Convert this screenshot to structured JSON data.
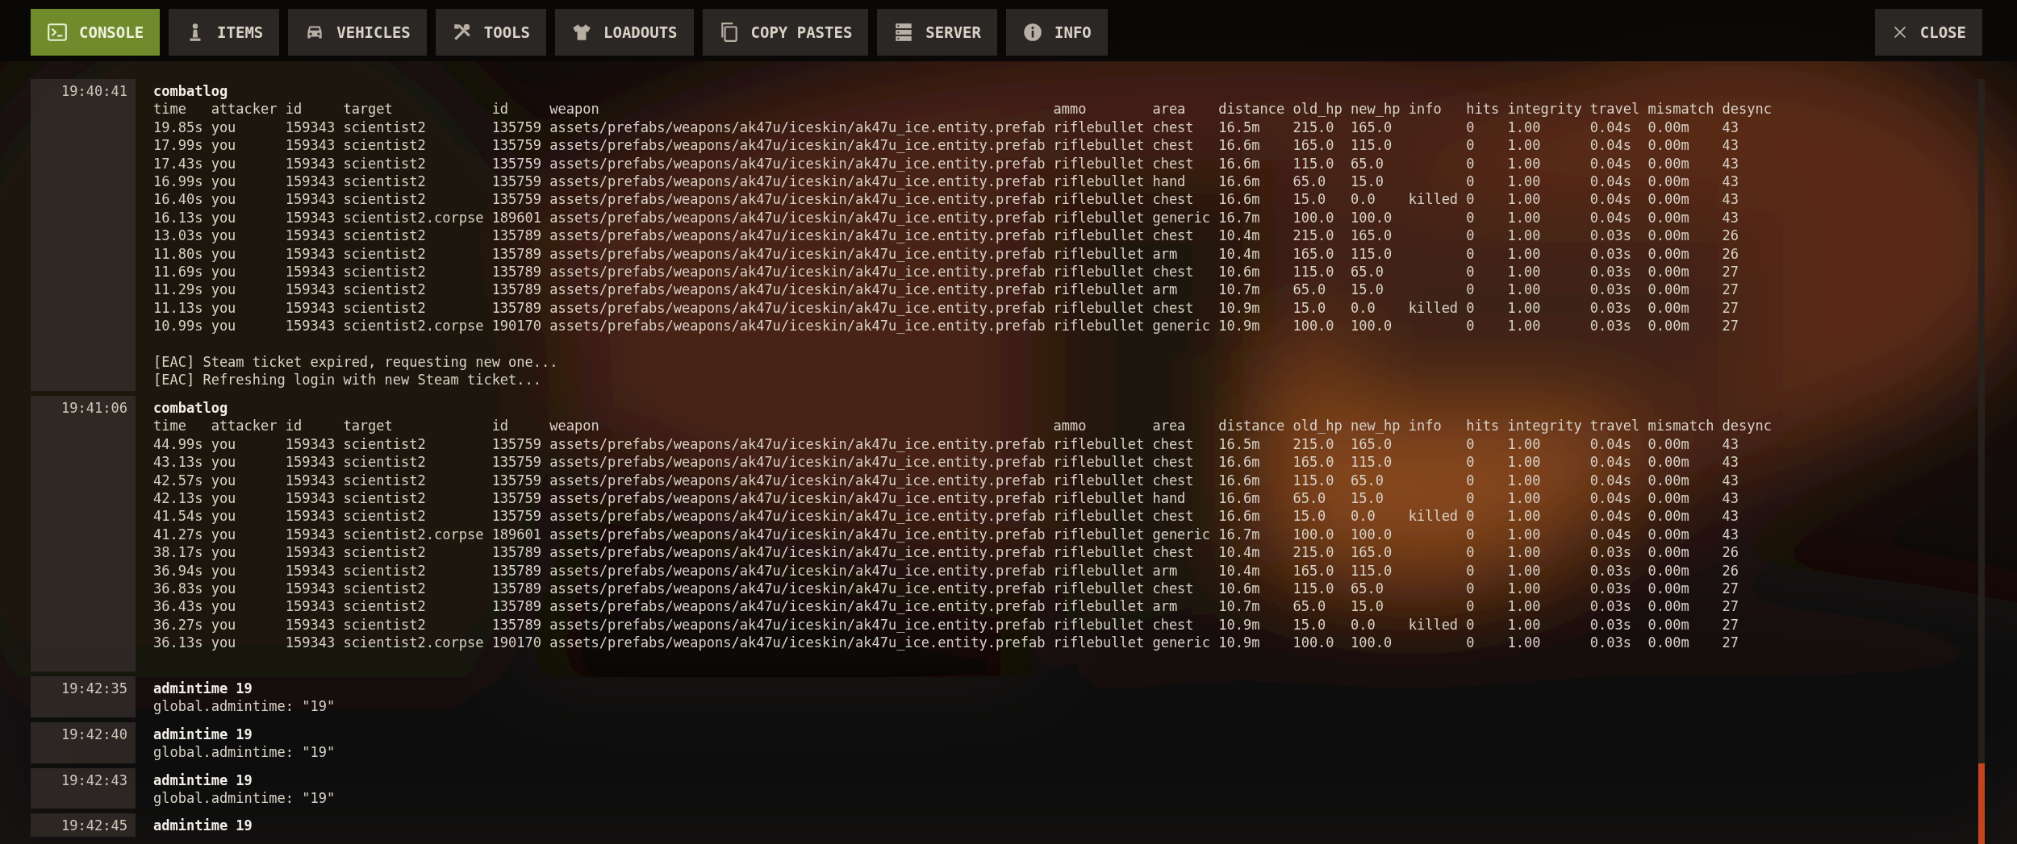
{
  "tabs": [
    {
      "label": "CONSOLE",
      "selected": true
    },
    {
      "label": "ITEMS",
      "selected": false
    },
    {
      "label": "VEHICLES",
      "selected": false
    },
    {
      "label": "TOOLS",
      "selected": false
    },
    {
      "label": "LOADOUTS",
      "selected": false
    },
    {
      "label": "COPY PASTES",
      "selected": false
    },
    {
      "label": "SERVER",
      "selected": false
    },
    {
      "label": "INFO",
      "selected": false
    }
  ],
  "close_button": {
    "label": "CLOSE"
  },
  "log": [
    {
      "time": "19:40:41",
      "command": "combatlog",
      "table": {
        "columns": [
          "time",
          "attacker",
          "id",
          "target",
          "id",
          "weapon",
          "ammo",
          "area",
          "distance",
          "old_hp",
          "new_hp",
          "info",
          "hits",
          "integrity",
          "travel",
          "mismatch",
          "desync"
        ],
        "rows": [
          [
            "19.85s",
            "you",
            "159343",
            "scientist2",
            "135759",
            "assets/prefabs/weapons/ak47u/iceskin/ak47u_ice.entity.prefab",
            "riflebullet",
            "chest",
            "16.5m",
            "215.0",
            "165.0",
            null,
            "0",
            "1.00",
            "0.04s",
            "0.00m",
            "43"
          ],
          [
            "17.99s",
            "you",
            "159343",
            "scientist2",
            "135759",
            "assets/prefabs/weapons/ak47u/iceskin/ak47u_ice.entity.prefab",
            "riflebullet",
            "chest",
            "16.6m",
            "165.0",
            "115.0",
            null,
            "0",
            "1.00",
            "0.04s",
            "0.00m",
            "43"
          ],
          [
            "17.43s",
            "you",
            "159343",
            "scientist2",
            "135759",
            "assets/prefabs/weapons/ak47u/iceskin/ak47u_ice.entity.prefab",
            "riflebullet",
            "chest",
            "16.6m",
            "115.0",
            "65.0",
            null,
            "0",
            "1.00",
            "0.04s",
            "0.00m",
            "43"
          ],
          [
            "16.99s",
            "you",
            "159343",
            "scientist2",
            "135759",
            "assets/prefabs/weapons/ak47u/iceskin/ak47u_ice.entity.prefab",
            "riflebullet",
            "hand",
            "16.6m",
            "65.0",
            "15.0",
            null,
            "0",
            "1.00",
            "0.04s",
            "0.00m",
            "43"
          ],
          [
            "16.40s",
            "you",
            "159343",
            "scientist2",
            "135759",
            "assets/prefabs/weapons/ak47u/iceskin/ak47u_ice.entity.prefab",
            "riflebullet",
            "chest",
            "16.6m",
            "15.0",
            "0.0",
            "killed",
            "0",
            "1.00",
            "0.04s",
            "0.00m",
            "43"
          ],
          [
            "16.13s",
            "you",
            "159343",
            "scientist2.corpse",
            "189601",
            "assets/prefabs/weapons/ak47u/iceskin/ak47u_ice.entity.prefab",
            "riflebullet",
            "generic",
            "16.7m",
            "100.0",
            "100.0",
            null,
            "0",
            "1.00",
            "0.04s",
            "0.00m",
            "43"
          ],
          [
            "13.03s",
            "you",
            "159343",
            "scientist2",
            "135789",
            "assets/prefabs/weapons/ak47u/iceskin/ak47u_ice.entity.prefab",
            "riflebullet",
            "chest",
            "10.4m",
            "215.0",
            "165.0",
            null,
            "0",
            "1.00",
            "0.03s",
            "0.00m",
            "26"
          ],
          [
            "11.80s",
            "you",
            "159343",
            "scientist2",
            "135789",
            "assets/prefabs/weapons/ak47u/iceskin/ak47u_ice.entity.prefab",
            "riflebullet",
            "arm",
            "10.4m",
            "165.0",
            "115.0",
            null,
            "0",
            "1.00",
            "0.03s",
            "0.00m",
            "26"
          ],
          [
            "11.69s",
            "you",
            "159343",
            "scientist2",
            "135789",
            "assets/prefabs/weapons/ak47u/iceskin/ak47u_ice.entity.prefab",
            "riflebullet",
            "chest",
            "10.6m",
            "115.0",
            "65.0",
            null,
            "0",
            "1.00",
            "0.03s",
            "0.00m",
            "27"
          ],
          [
            "11.29s",
            "you",
            "159343",
            "scientist2",
            "135789",
            "assets/prefabs/weapons/ak47u/iceskin/ak47u_ice.entity.prefab",
            "riflebullet",
            "arm",
            "10.7m",
            "65.0",
            "15.0",
            null,
            "0",
            "1.00",
            "0.03s",
            "0.00m",
            "27"
          ],
          [
            "11.13s",
            "you",
            "159343",
            "scientist2",
            "135789",
            "assets/prefabs/weapons/ak47u/iceskin/ak47u_ice.entity.prefab",
            "riflebullet",
            "chest",
            "10.9m",
            "15.0",
            "0.0",
            "killed",
            "0",
            "1.00",
            "0.03s",
            "0.00m",
            "27"
          ],
          [
            "10.99s",
            "you",
            "159343",
            "scientist2.corpse",
            "190170",
            "assets/prefabs/weapons/ak47u/iceskin/ak47u_ice.entity.prefab",
            "riflebullet",
            "generic",
            "10.9m",
            "100.0",
            "100.0",
            null,
            "0",
            "1.00",
            "0.03s",
            "0.00m",
            "27"
          ]
        ]
      },
      "output": [
        "[EAC] Steam ticket expired, requesting new one...",
        "[EAC] Refreshing login with new Steam ticket..."
      ]
    },
    {
      "time": "19:41:06",
      "command": "combatlog",
      "table": {
        "columns": [
          "time",
          "attacker",
          "id",
          "target",
          "id",
          "weapon",
          "ammo",
          "area",
          "distance",
          "old_hp",
          "new_hp",
          "info",
          "hits",
          "integrity",
          "travel",
          "mismatch",
          "desync"
        ],
        "rows": [
          [
            "44.99s",
            "you",
            "159343",
            "scientist2",
            "135759",
            "assets/prefabs/weapons/ak47u/iceskin/ak47u_ice.entity.prefab",
            "riflebullet",
            "chest",
            "16.5m",
            "215.0",
            "165.0",
            null,
            "0",
            "1.00",
            "0.04s",
            "0.00m",
            "43"
          ],
          [
            "43.13s",
            "you",
            "159343",
            "scientist2",
            "135759",
            "assets/prefabs/weapons/ak47u/iceskin/ak47u_ice.entity.prefab",
            "riflebullet",
            "chest",
            "16.6m",
            "165.0",
            "115.0",
            null,
            "0",
            "1.00",
            "0.04s",
            "0.00m",
            "43"
          ],
          [
            "42.57s",
            "you",
            "159343",
            "scientist2",
            "135759",
            "assets/prefabs/weapons/ak47u/iceskin/ak47u_ice.entity.prefab",
            "riflebullet",
            "chest",
            "16.6m",
            "115.0",
            "65.0",
            null,
            "0",
            "1.00",
            "0.04s",
            "0.00m",
            "43"
          ],
          [
            "42.13s",
            "you",
            "159343",
            "scientist2",
            "135759",
            "assets/prefabs/weapons/ak47u/iceskin/ak47u_ice.entity.prefab",
            "riflebullet",
            "hand",
            "16.6m",
            "65.0",
            "15.0",
            null,
            "0",
            "1.00",
            "0.04s",
            "0.00m",
            "43"
          ],
          [
            "41.54s",
            "you",
            "159343",
            "scientist2",
            "135759",
            "assets/prefabs/weapons/ak47u/iceskin/ak47u_ice.entity.prefab",
            "riflebullet",
            "chest",
            "16.6m",
            "15.0",
            "0.0",
            "killed",
            "0",
            "1.00",
            "0.04s",
            "0.00m",
            "43"
          ],
          [
            "41.27s",
            "you",
            "159343",
            "scientist2.corpse",
            "189601",
            "assets/prefabs/weapons/ak47u/iceskin/ak47u_ice.entity.prefab",
            "riflebullet",
            "generic",
            "16.7m",
            "100.0",
            "100.0",
            null,
            "0",
            "1.00",
            "0.04s",
            "0.00m",
            "43"
          ],
          [
            "38.17s",
            "you",
            "159343",
            "scientist2",
            "135789",
            "assets/prefabs/weapons/ak47u/iceskin/ak47u_ice.entity.prefab",
            "riflebullet",
            "chest",
            "10.4m",
            "215.0",
            "165.0",
            null,
            "0",
            "1.00",
            "0.03s",
            "0.00m",
            "26"
          ],
          [
            "36.94s",
            "you",
            "159343",
            "scientist2",
            "135789",
            "assets/prefabs/weapons/ak47u/iceskin/ak47u_ice.entity.prefab",
            "riflebullet",
            "arm",
            "10.4m",
            "165.0",
            "115.0",
            null,
            "0",
            "1.00",
            "0.03s",
            "0.00m",
            "26"
          ],
          [
            "36.83s",
            "you",
            "159343",
            "scientist2",
            "135789",
            "assets/prefabs/weapons/ak47u/iceskin/ak47u_ice.entity.prefab",
            "riflebullet",
            "chest",
            "10.6m",
            "115.0",
            "65.0",
            null,
            "0",
            "1.00",
            "0.03s",
            "0.00m",
            "27"
          ],
          [
            "36.43s",
            "you",
            "159343",
            "scientist2",
            "135789",
            "assets/prefabs/weapons/ak47u/iceskin/ak47u_ice.entity.prefab",
            "riflebullet",
            "arm",
            "10.7m",
            "65.0",
            "15.0",
            null,
            "0",
            "1.00",
            "0.03s",
            "0.00m",
            "27"
          ],
          [
            "36.27s",
            "you",
            "159343",
            "scientist2",
            "135789",
            "assets/prefabs/weapons/ak47u/iceskin/ak47u_ice.entity.prefab",
            "riflebullet",
            "chest",
            "10.9m",
            "15.0",
            "0.0",
            "killed",
            "0",
            "1.00",
            "0.03s",
            "0.00m",
            "27"
          ],
          [
            "36.13s",
            "you",
            "159343",
            "scientist2.corpse",
            "190170",
            "assets/prefabs/weapons/ak47u/iceskin/ak47u_ice.entity.prefab",
            "riflebullet",
            "generic",
            "10.9m",
            "100.0",
            "100.0",
            null,
            "0",
            "1.00",
            "0.03s",
            "0.00m",
            "27"
          ]
        ]
      }
    },
    {
      "time": "19:42:35",
      "command": "admintime 19",
      "output": [
        "global.admintime: \"19\""
      ]
    },
    {
      "time": "19:42:40",
      "command": "admintime 19",
      "output": [
        "global.admintime: \"19\""
      ]
    },
    {
      "time": "19:42:43",
      "command": "admintime 19",
      "output": [
        "global.admintime: \"19\""
      ]
    },
    {
      "time": "19:42:45",
      "command": "admintime 19"
    }
  ]
}
